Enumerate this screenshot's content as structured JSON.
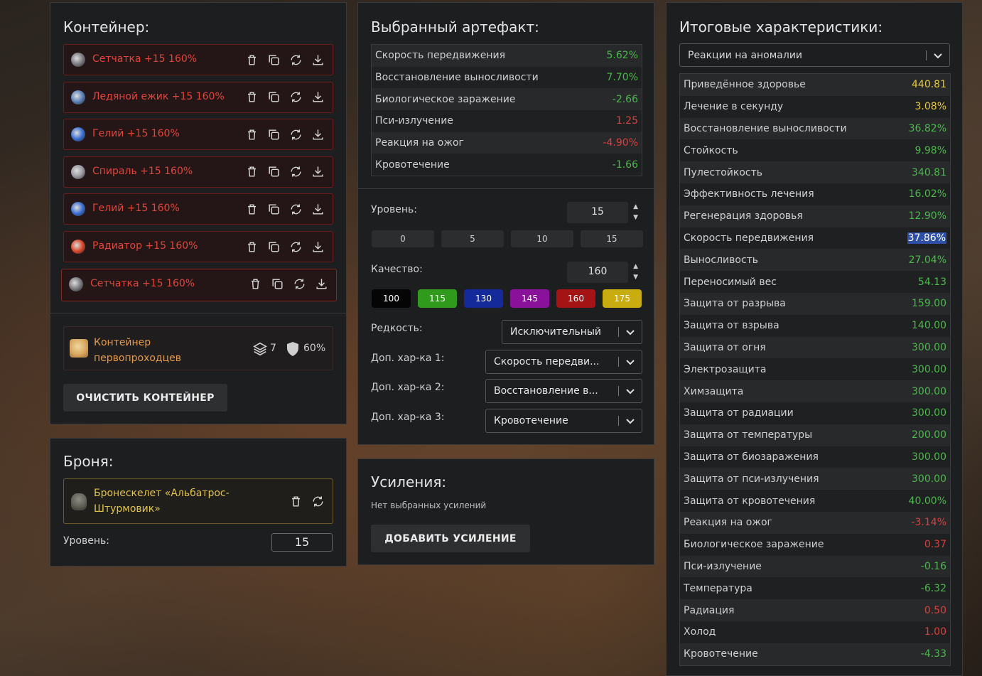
{
  "container": {
    "title": "Контейнер:",
    "items": [
      {
        "name": "Сетчатка +15 160%",
        "icon": "setchatka-icon",
        "color": "#7a7a80"
      },
      {
        "name": "Ледяной ежик +15 160%",
        "icon": "ice-hedgehog-icon",
        "color": "#5a7fb8"
      },
      {
        "name": "Гелий +15 160%",
        "icon": "helium-icon",
        "color": "#3b6fd1"
      },
      {
        "name": "Спираль +15 160%",
        "icon": "spiral-icon",
        "color": "#9a9aa0"
      },
      {
        "name": "Гелий +15 160%",
        "icon": "helium-icon",
        "color": "#3b6fd1"
      },
      {
        "name": "Радиатор +15 160%",
        "icon": "radiator-icon",
        "color": "#d8482a"
      },
      {
        "name": "Сетчатка +15 160%",
        "icon": "setchatka-icon",
        "color": "#7a7a80"
      }
    ],
    "container_name": "Контейнер первопроходцев",
    "slots": "7",
    "protection": "60%",
    "clear_label": "ОЧИСТИТЬ КОНТЕЙНЕР"
  },
  "armor": {
    "title": "Броня:",
    "name": "Бронескелет «Альбатрос-Штурмовик»",
    "level_label": "Уровень:",
    "level_value": "15"
  },
  "artifact": {
    "title": "Выбранный артефакт:",
    "stats": [
      {
        "label": "Скорость передвижения",
        "value": "5.62%",
        "kind": "pos"
      },
      {
        "label": "Восстановление выносливости",
        "value": "7.70%",
        "kind": "pos"
      },
      {
        "label": "Биологическое заражение",
        "value": "-2.66",
        "kind": "pos"
      },
      {
        "label": "Пси-излучение",
        "value": "1.25",
        "kind": "neg"
      },
      {
        "label": "Реакция на ожог",
        "value": "-4.90%",
        "kind": "neg"
      },
      {
        "label": "Кровотечение",
        "value": "-1.66",
        "kind": "pos"
      }
    ],
    "level_label": "Уровень:",
    "level_value": "15",
    "level_presets": [
      "0",
      "5",
      "10",
      "15"
    ],
    "quality_label": "Качество:",
    "quality_value": "160",
    "quality_presets": [
      {
        "label": "100",
        "color": "#050505",
        "text": "#ffffff"
      },
      {
        "label": "115",
        "color": "#2f9a1c",
        "text": "#ffffff"
      },
      {
        "label": "130",
        "color": "#152a9a",
        "text": "#ffffff"
      },
      {
        "label": "145",
        "color": "#8a129a",
        "text": "#ffffff"
      },
      {
        "label": "160",
        "color": "#a41414",
        "text": "#ffffff"
      },
      {
        "label": "175",
        "color": "#c9ac10",
        "text": "#ffffff"
      }
    ],
    "rarity_label": "Редкость:",
    "rarity_value": "Исключительный",
    "extra1_label": "Доп. хар-ка 1:",
    "extra1_value": "Скорость передви...",
    "extra2_label": "Доп. хар-ка 2:",
    "extra2_value": "Восстановление в...",
    "extra3_label": "Доп. хар-ка 3:",
    "extra3_value": "Кровотечение"
  },
  "boosts": {
    "title": "Усиления:",
    "empty_text": "Нет выбранных усилений",
    "add_label": "ДОБАВИТЬ УСИЛЕНИЕ"
  },
  "totals": {
    "title": "Итоговые характеристики:",
    "filter_value": "Реакции на аномалии",
    "stats": [
      {
        "label": "Приведённое здоровье",
        "value": "440.81",
        "kind": "gold"
      },
      {
        "label": "Лечение в секунду",
        "value": "3.08%",
        "kind": "gold"
      },
      {
        "label": "Восстановление выносливости",
        "value": "36.82%",
        "kind": "pos"
      },
      {
        "label": "Стойкость",
        "value": "9.98%",
        "kind": "pos"
      },
      {
        "label": "Пулестойкость",
        "value": "340.81",
        "kind": "pos"
      },
      {
        "label": "Эффективность лечения",
        "value": "16.02%",
        "kind": "pos"
      },
      {
        "label": "Регенерация здоровья",
        "value": "12.90%",
        "kind": "pos"
      },
      {
        "label": "Скорость передвижения",
        "value": "37.86%",
        "kind": "sel"
      },
      {
        "label": "Выносливость",
        "value": "27.04%",
        "kind": "pos"
      },
      {
        "label": "Переносимый вес",
        "value": "54.13",
        "kind": "pos"
      },
      {
        "label": "Защита от разрыва",
        "value": "159.00",
        "kind": "pos"
      },
      {
        "label": "Защита от взрыва",
        "value": "140.00",
        "kind": "pos"
      },
      {
        "label": "Защита от огня",
        "value": "300.00",
        "kind": "pos"
      },
      {
        "label": "Электрозащита",
        "value": "300.00",
        "kind": "pos"
      },
      {
        "label": "Химзащита",
        "value": "300.00",
        "kind": "pos"
      },
      {
        "label": "Защита от радиации",
        "value": "300.00",
        "kind": "pos"
      },
      {
        "label": "Защита от температуры",
        "value": "200.00",
        "kind": "pos"
      },
      {
        "label": "Защита от биозаражения",
        "value": "300.00",
        "kind": "pos"
      },
      {
        "label": "Защита от пси-излучения",
        "value": "300.00",
        "kind": "pos"
      },
      {
        "label": "Защита от кровотечения",
        "value": "40.00%",
        "kind": "pos"
      },
      {
        "label": "Реакция на ожог",
        "value": "-3.14%",
        "kind": "neg"
      },
      {
        "label": "Биологическое заражение",
        "value": "0.37",
        "kind": "neg"
      },
      {
        "label": "Пси-излучение",
        "value": "-0.16",
        "kind": "pos"
      },
      {
        "label": "Температура",
        "value": "-6.32",
        "kind": "pos"
      },
      {
        "label": "Радиация",
        "value": "0.50",
        "kind": "neg"
      },
      {
        "label": "Холод",
        "value": "1.00",
        "kind": "neg"
      },
      {
        "label": "Кровотечение",
        "value": "-4.33",
        "kind": "pos"
      }
    ]
  }
}
